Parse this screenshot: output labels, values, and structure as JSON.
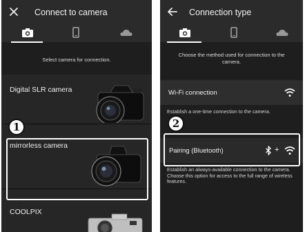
{
  "left": {
    "title": "Connect to camera",
    "instruction": "Select camera for connection.",
    "cameras": [
      {
        "label": "Digital SLR camera"
      },
      {
        "label": "mirrorless camera"
      },
      {
        "label": "COOLPIX"
      }
    ],
    "callout": "1"
  },
  "right": {
    "title": "Connection type",
    "instruction": "Choose the method used for connection to the camera.",
    "wifi": {
      "label": "Wi-Fi connection",
      "desc": "Establish a one-time connection to the camera."
    },
    "pairing": {
      "label": "Pairing (Bluetooth)",
      "plus": "+",
      "desc": "Establish an always-available connection to the camera.\nChoose this option for access to the full range of wireless features."
    },
    "callout": "2"
  },
  "icons": {
    "close": "close-icon",
    "back": "arrow-left-icon",
    "tabs": [
      "camera-icon",
      "phone-icon",
      "cloud-icon"
    ]
  },
  "colors": {
    "background": "#1c1c1c",
    "bar": "#2b2b2b",
    "highlight": "#ffffff"
  }
}
